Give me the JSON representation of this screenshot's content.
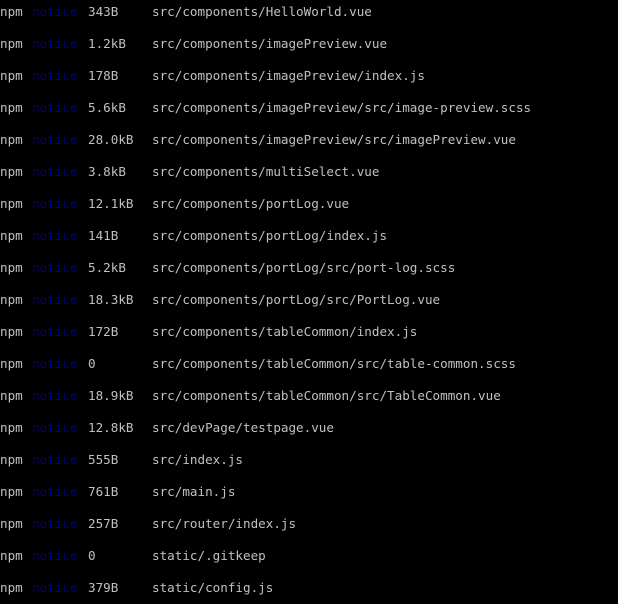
{
  "terminal": {
    "colors": {
      "background": "#000000",
      "text": "#c0c0c0",
      "notice": "#000080"
    },
    "lines": [
      {
        "prefix": "npm",
        "level": "notice",
        "size": "343B",
        "path": "src/components/HelloWorld.vue"
      },
      {
        "prefix": "npm",
        "level": "notice",
        "size": "1.2kB",
        "path": "src/components/imagePreview.vue"
      },
      {
        "prefix": "npm",
        "level": "notice",
        "size": "178B",
        "path": "src/components/imagePreview/index.js"
      },
      {
        "prefix": "npm",
        "level": "notice",
        "size": "5.6kB",
        "path": "src/components/imagePreview/src/image-preview.scss"
      },
      {
        "prefix": "npm",
        "level": "notice",
        "size": "28.0kB",
        "path": "src/components/imagePreview/src/imagePreview.vue"
      },
      {
        "prefix": "npm",
        "level": "notice",
        "size": "3.8kB",
        "path": "src/components/multiSelect.vue"
      },
      {
        "prefix": "npm",
        "level": "notice",
        "size": "12.1kB",
        "path": "src/components/portLog.vue"
      },
      {
        "prefix": "npm",
        "level": "notice",
        "size": "141B",
        "path": "src/components/portLog/index.js"
      },
      {
        "prefix": "npm",
        "level": "notice",
        "size": "5.2kB",
        "path": "src/components/portLog/src/port-log.scss"
      },
      {
        "prefix": "npm",
        "level": "notice",
        "size": "18.3kB",
        "path": "src/components/portLog/src/PortLog.vue"
      },
      {
        "prefix": "npm",
        "level": "notice",
        "size": "172B",
        "path": "src/components/tableCommon/index.js"
      },
      {
        "prefix": "npm",
        "level": "notice",
        "size": "0",
        "path": "src/components/tableCommon/src/table-common.scss"
      },
      {
        "prefix": "npm",
        "level": "notice",
        "size": "18.9kB",
        "path": "src/components/tableCommon/src/TableCommon.vue"
      },
      {
        "prefix": "npm",
        "level": "notice",
        "size": "12.8kB",
        "path": "src/devPage/testpage.vue"
      },
      {
        "prefix": "npm",
        "level": "notice",
        "size": "555B",
        "path": "src/index.js"
      },
      {
        "prefix": "npm",
        "level": "notice",
        "size": "761B",
        "path": "src/main.js"
      },
      {
        "prefix": "npm",
        "level": "notice",
        "size": "257B",
        "path": "src/router/index.js"
      },
      {
        "prefix": "npm",
        "level": "notice",
        "size": "0",
        "path": "static/.gitkeep"
      },
      {
        "prefix": "npm",
        "level": "notice",
        "size": "379B",
        "path": "static/config.js"
      }
    ]
  }
}
